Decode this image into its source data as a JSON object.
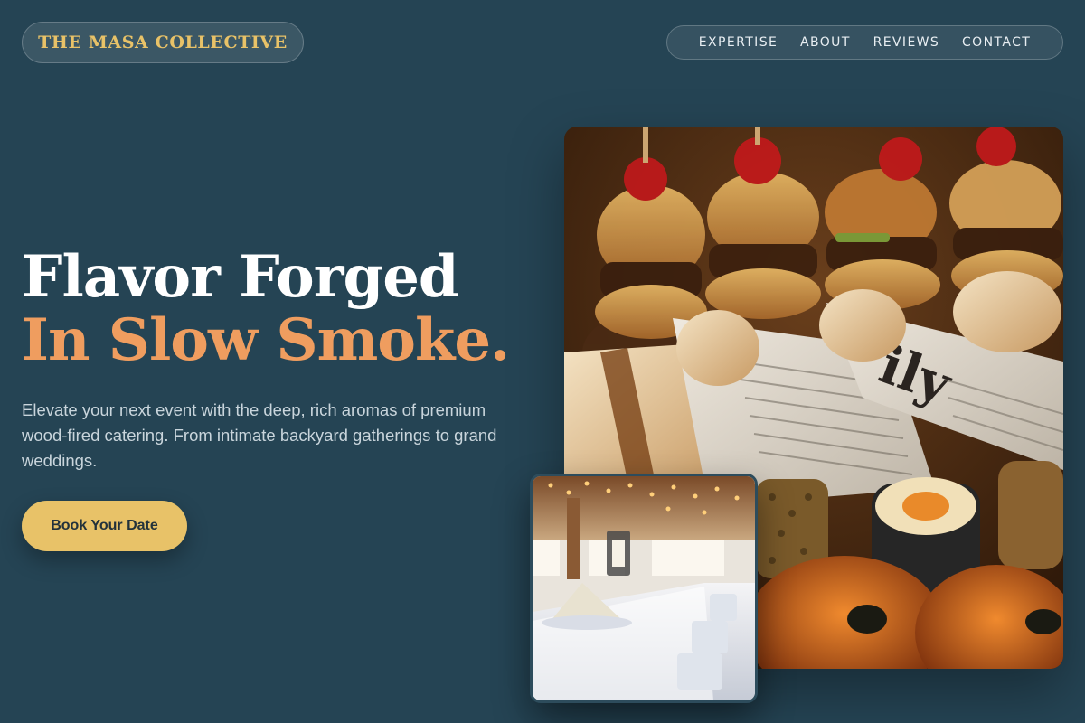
{
  "header": {
    "brand": "THE MASA COLLECTIVE",
    "nav": [
      {
        "label": "EXPERTISE"
      },
      {
        "label": "ABOUT"
      },
      {
        "label": "REVIEWS"
      },
      {
        "label": "CONTACT"
      }
    ]
  },
  "hero": {
    "headline_line1": "Flavor Forged",
    "headline_line2": "In Slow Smoke.",
    "lead": "Elevate your next event with the deep, rich aromas of premium wood-fired catering. From intimate backyard gatherings to grand weddings.",
    "cta_label": "Book Your Date"
  },
  "images": {
    "main_photo": "catering platter of sliders, newspaper-wrapped wraps, sushi rolls and pastries",
    "small_photo": "banquet hall with long white-dressed table and string lights"
  },
  "colors": {
    "background": "#254454",
    "accent_gold": "#e8c268",
    "accent_orange": "#ef9d5f",
    "text_muted": "#c9d5dc"
  }
}
